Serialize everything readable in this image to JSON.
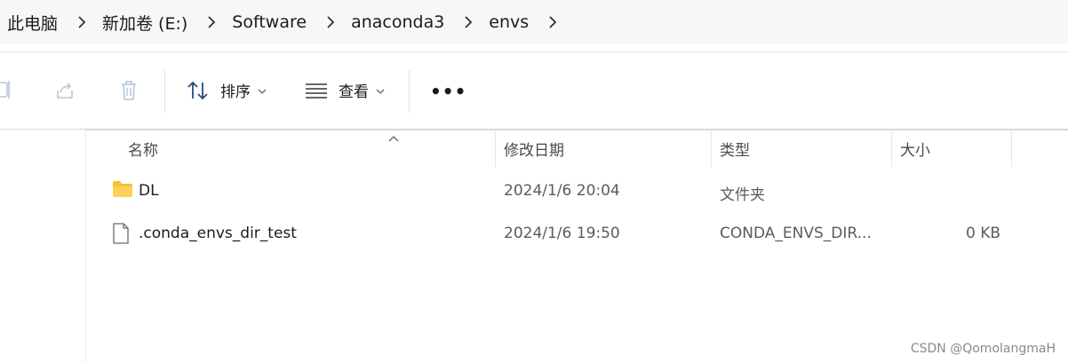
{
  "breadcrumb": {
    "items": [
      "此电脑",
      "新加卷 (E:)",
      "Software",
      "anaconda3",
      "envs"
    ]
  },
  "toolbar": {
    "sort_label": "排序",
    "view_label": "查看",
    "more_label": "•••"
  },
  "columns": {
    "name": "名称",
    "date": "修改日期",
    "type": "类型",
    "size": "大小"
  },
  "files": [
    {
      "name": "DL",
      "date": "2024/1/6 20:04",
      "type": "文件夹",
      "size": "",
      "icon": "folder-icon"
    },
    {
      "name": ".conda_envs_dir_test",
      "date": "2024/1/6 19:50",
      "type": "CONDA_ENVS_DIR...",
      "size": "0 KB",
      "icon": "file-icon"
    }
  ],
  "watermark": "CSDN @QomolangmaH",
  "colors": {
    "folder": "#f2c23a",
    "breadcrumb_bg": "#f7f7f7"
  }
}
